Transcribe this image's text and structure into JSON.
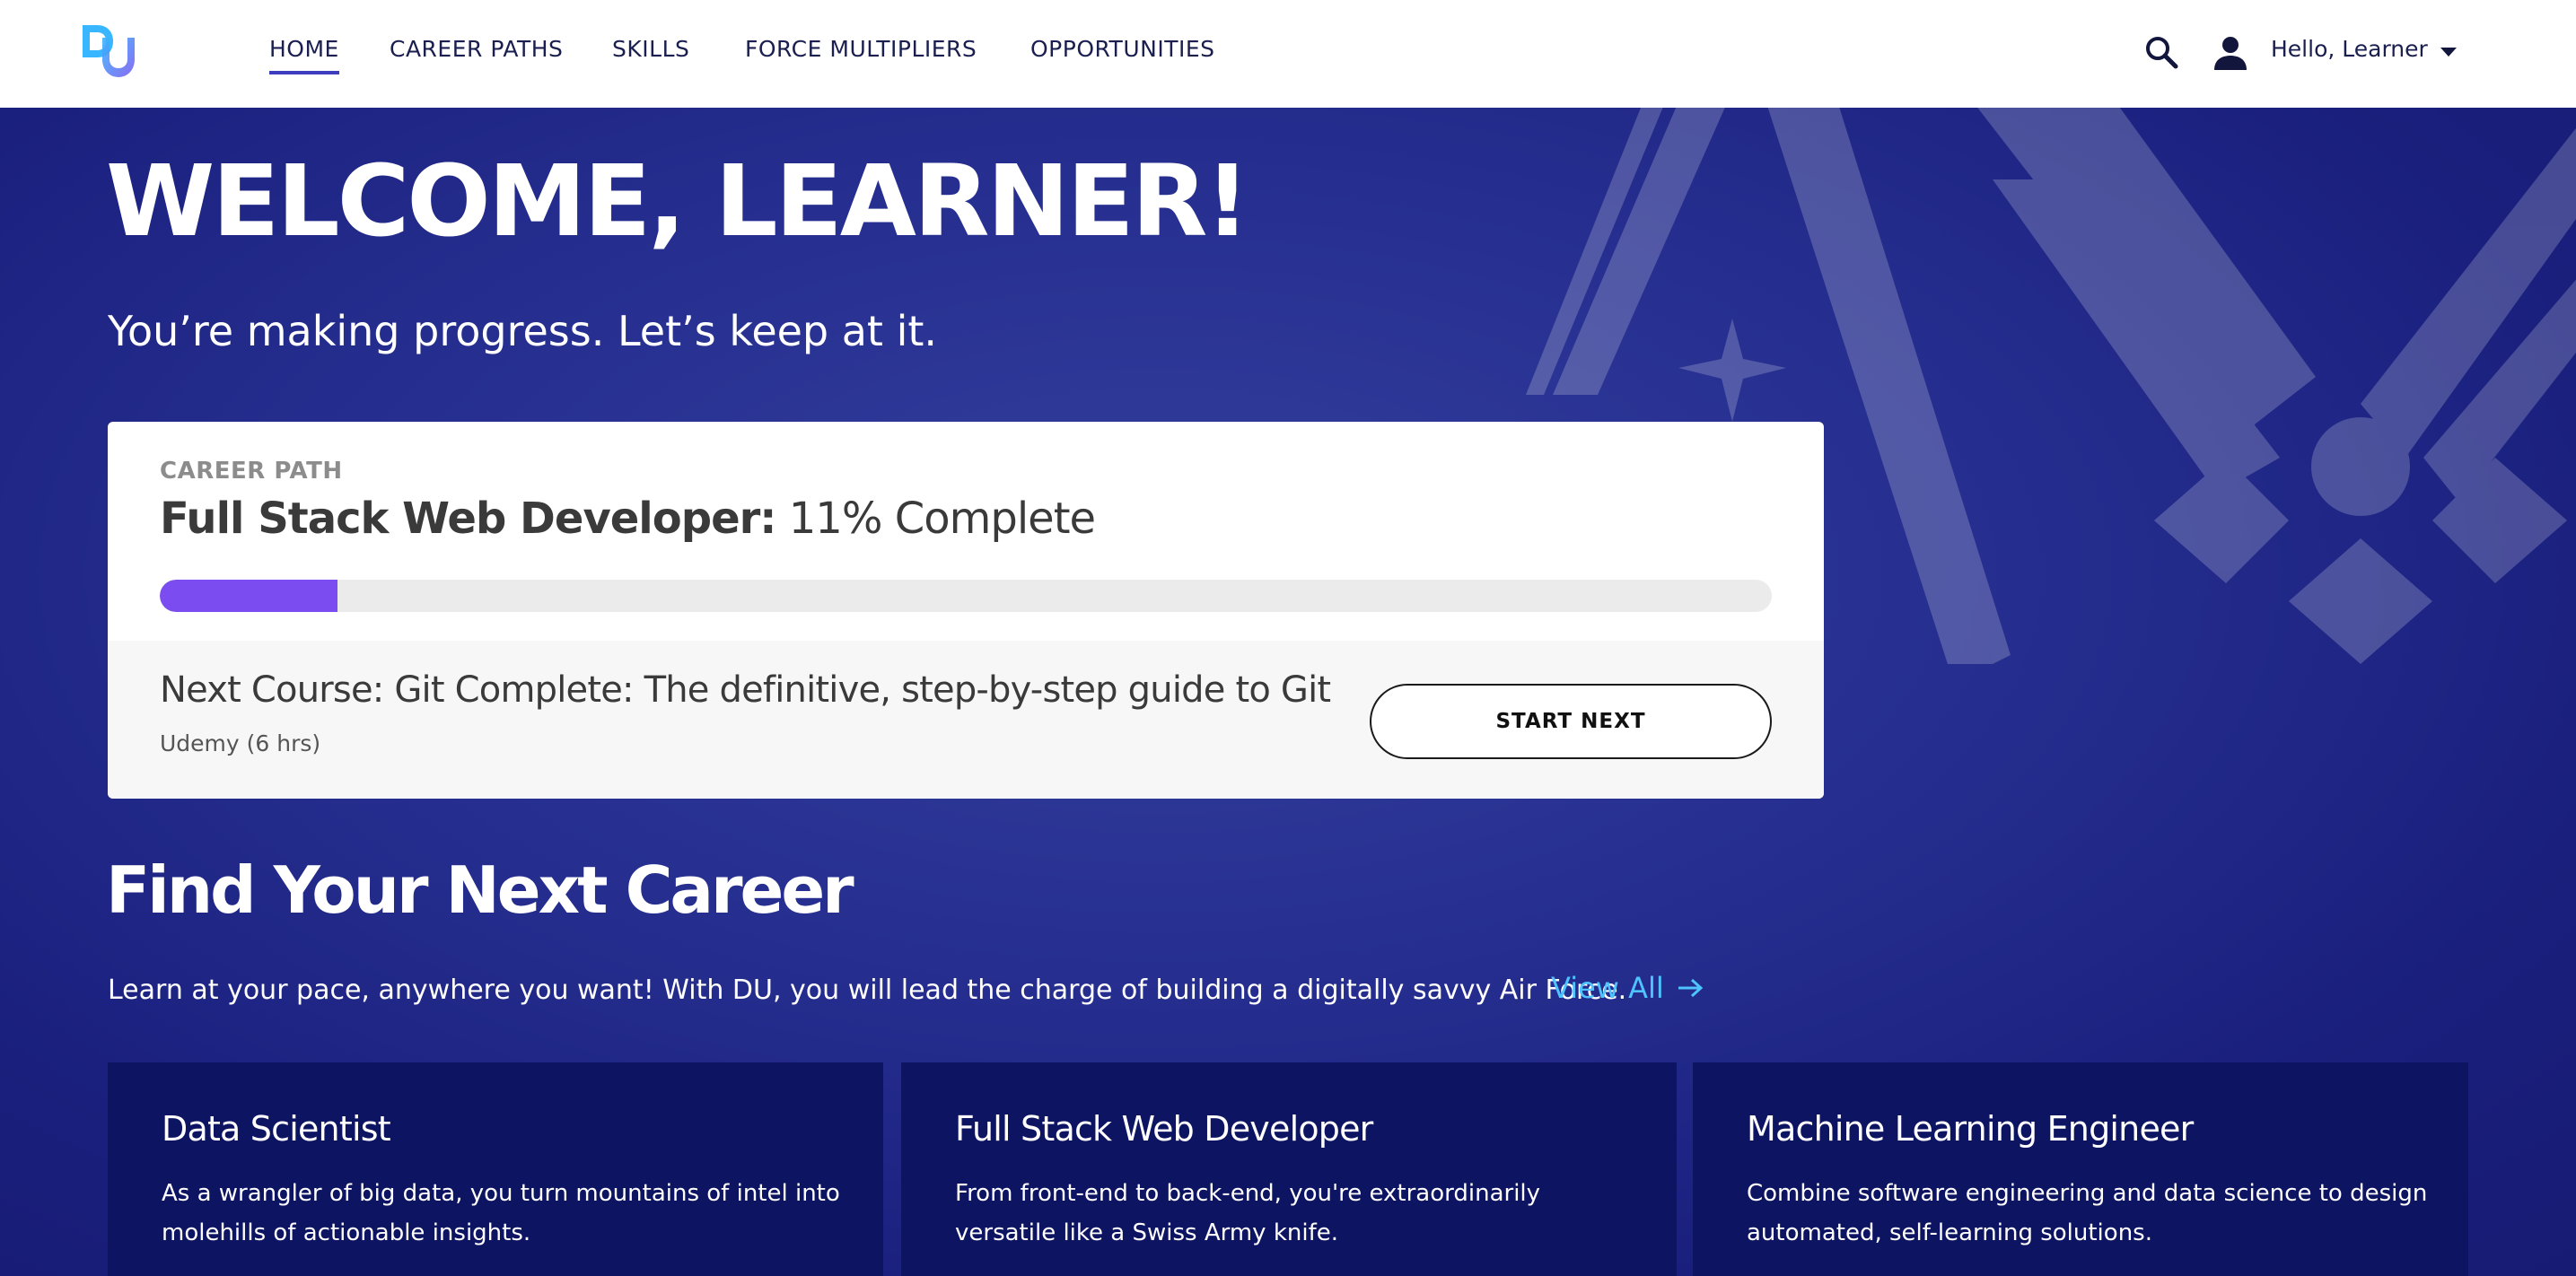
{
  "nav": {
    "items": [
      {
        "label": "HOME",
        "active": true
      },
      {
        "label": "CAREER PATHS",
        "active": false
      },
      {
        "label": "SKILLS",
        "active": false
      },
      {
        "label": "FORCE MULTIPLIERS",
        "active": false
      },
      {
        "label": "OPPORTUNITIES",
        "active": false
      }
    ],
    "user_greeting": "Hello, Learner",
    "icons": {
      "logo": "du-logo-icon",
      "search": "search-icon",
      "user": "user-icon",
      "dropdown": "caret-down-icon"
    }
  },
  "hero": {
    "title": "WELCOME, LEARNER!",
    "subtitle": "You’re making progress. Let’s keep at it."
  },
  "career_card": {
    "eyebrow": "CAREER PATH",
    "path_name": "Full Stack Web Developer:",
    "progress_text": "11% Complete",
    "progress_percent": 11,
    "next_course": "Next Course: Git Complete: The definitive, step-by-step guide to Git",
    "course_meta": "Udemy (6 hrs)",
    "start_button": "START NEXT"
  },
  "find_career": {
    "title": "Find Your Next Career",
    "subtitle": "Learn at your pace, anywhere you want! With DU, you will lead the charge of building a digitally savvy Air Force.",
    "view_all": "View All",
    "careers": [
      {
        "title": "Data Scientist",
        "description": "As a wrangler of big data, you turn mountains of intel into molehills of actionable insights."
      },
      {
        "title": "Full Stack Web Developer",
        "description": "From front-end to back-end, you're extraordinarily versatile like a Swiss Army knife."
      },
      {
        "title": "Machine Learning Engineer",
        "description": "Combine software engineering and data science to design automated, self-learning solutions."
      }
    ]
  },
  "colors": {
    "brand_navy": "#1b2283",
    "tile_bg": "#0d1461",
    "progress": "#7b4cf0",
    "link": "#4fc3ff",
    "nav_active": "#3f3dbf"
  }
}
